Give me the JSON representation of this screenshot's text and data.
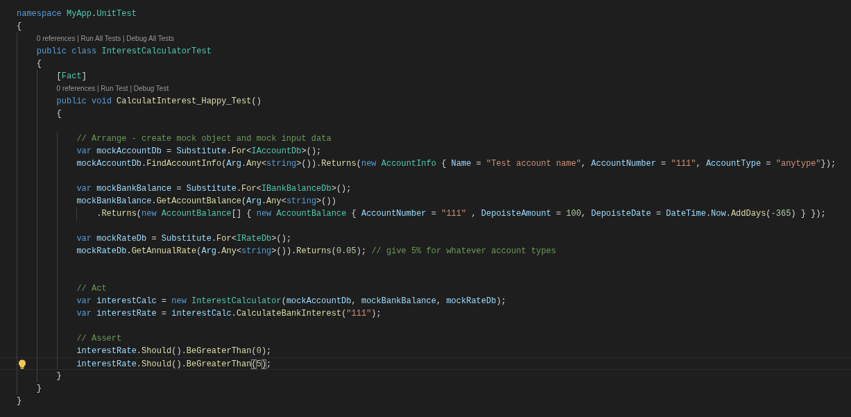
{
  "editor": {
    "lines": [
      {
        "kind": "code",
        "tokens": [
          {
            "t": "namespace",
            "kind": "keyword"
          },
          {
            "t": " MyApp",
            "kind": "type"
          },
          {
            "t": ".",
            "kind": "punctuation"
          },
          {
            "t": "UnitTest",
            "kind": "type"
          }
        ]
      },
      {
        "kind": "code",
        "tokens": [
          {
            "t": "{",
            "kind": "punctuation"
          }
        ]
      },
      {
        "kind": "codelens",
        "tokens": [
          {
            "t": "    0 references | Run All Tests | Debug All Tests",
            "kind": "lens"
          }
        ]
      },
      {
        "kind": "code",
        "tokens": [
          {
            "t": "    public",
            "kind": "keyword"
          },
          {
            "t": " class",
            "kind": "keyword"
          },
          {
            "t": " InterestCalculatorTest",
            "kind": "type"
          }
        ]
      },
      {
        "kind": "code",
        "tokens": [
          {
            "t": "    {",
            "kind": "punctuation"
          }
        ]
      },
      {
        "kind": "code",
        "tokens": [
          {
            "t": "        [",
            "kind": "punctuation"
          },
          {
            "t": "Fact",
            "kind": "type"
          },
          {
            "t": "]",
            "kind": "punctuation"
          }
        ]
      },
      {
        "kind": "codelens",
        "tokens": [
          {
            "t": "        0 references | Run Test | Debug Test",
            "kind": "lens"
          }
        ]
      },
      {
        "kind": "code",
        "tokens": [
          {
            "t": "        public",
            "kind": "keyword"
          },
          {
            "t": " void",
            "kind": "keyword"
          },
          {
            "t": " CalculatInterest_Happy_Test",
            "kind": "function"
          },
          {
            "t": "()",
            "kind": "punctuation"
          }
        ]
      },
      {
        "kind": "code",
        "tokens": [
          {
            "t": "        {",
            "kind": "punctuation"
          }
        ]
      },
      {
        "kind": "blank"
      },
      {
        "kind": "code",
        "tokens": [
          {
            "t": "            // Arrange - create mock object and mock input data",
            "kind": "comment"
          }
        ]
      },
      {
        "kind": "code",
        "tokens": [
          {
            "t": "            var",
            "kind": "keyword"
          },
          {
            "t": " mockAccountDb",
            "kind": "variable"
          },
          {
            "t": " = ",
            "kind": "punctuation"
          },
          {
            "t": "Substitute",
            "kind": "variable"
          },
          {
            "t": ".",
            "kind": "punctuation"
          },
          {
            "t": "For",
            "kind": "function"
          },
          {
            "t": "<",
            "kind": "punctuation"
          },
          {
            "t": "IAccountDb",
            "kind": "type"
          },
          {
            "t": ">();",
            "kind": "punctuation"
          }
        ]
      },
      {
        "kind": "code",
        "tokens": [
          {
            "t": "            mockAccountDb",
            "kind": "variable"
          },
          {
            "t": ".",
            "kind": "punctuation"
          },
          {
            "t": "FindAccountInfo",
            "kind": "function"
          },
          {
            "t": "(",
            "kind": "punctuation"
          },
          {
            "t": "Arg",
            "kind": "variable"
          },
          {
            "t": ".",
            "kind": "punctuation"
          },
          {
            "t": "Any",
            "kind": "function"
          },
          {
            "t": "<",
            "kind": "punctuation"
          },
          {
            "t": "string",
            "kind": "keyword"
          },
          {
            "t": ">()).",
            "kind": "punctuation"
          },
          {
            "t": "Returns",
            "kind": "function"
          },
          {
            "t": "(",
            "kind": "punctuation"
          },
          {
            "t": "new",
            "kind": "keyword"
          },
          {
            "t": " AccountInfo",
            "kind": "type"
          },
          {
            "t": " { ",
            "kind": "punctuation"
          },
          {
            "t": "Name",
            "kind": "variable"
          },
          {
            "t": " = ",
            "kind": "punctuation"
          },
          {
            "t": "\"Test account name\"",
            "kind": "string"
          },
          {
            "t": ", ",
            "kind": "punctuation"
          },
          {
            "t": "AccountNumber",
            "kind": "variable"
          },
          {
            "t": " = ",
            "kind": "punctuation"
          },
          {
            "t": "\"111\"",
            "kind": "string"
          },
          {
            "t": ", ",
            "kind": "punctuation"
          },
          {
            "t": "AccountType",
            "kind": "variable"
          },
          {
            "t": " = ",
            "kind": "punctuation"
          },
          {
            "t": "\"anytype\"",
            "kind": "string"
          },
          {
            "t": "});",
            "kind": "punctuation"
          }
        ]
      },
      {
        "kind": "blank"
      },
      {
        "kind": "code",
        "tokens": [
          {
            "t": "            var",
            "kind": "keyword"
          },
          {
            "t": " mockBankBalance",
            "kind": "variable"
          },
          {
            "t": " = ",
            "kind": "punctuation"
          },
          {
            "t": "Substitute",
            "kind": "variable"
          },
          {
            "t": ".",
            "kind": "punctuation"
          },
          {
            "t": "For",
            "kind": "function"
          },
          {
            "t": "<",
            "kind": "punctuation"
          },
          {
            "t": "IBankBalanceDb",
            "kind": "type"
          },
          {
            "t": ">();",
            "kind": "punctuation"
          }
        ]
      },
      {
        "kind": "code",
        "tokens": [
          {
            "t": "            mockBankBalance",
            "kind": "variable"
          },
          {
            "t": ".",
            "kind": "punctuation"
          },
          {
            "t": "GetAccountBalance",
            "kind": "function"
          },
          {
            "t": "(",
            "kind": "punctuation"
          },
          {
            "t": "Arg",
            "kind": "variable"
          },
          {
            "t": ".",
            "kind": "punctuation"
          },
          {
            "t": "Any",
            "kind": "function"
          },
          {
            "t": "<",
            "kind": "punctuation"
          },
          {
            "t": "string",
            "kind": "keyword"
          },
          {
            "t": ">())",
            "kind": "punctuation"
          }
        ]
      },
      {
        "kind": "code",
        "tokens": [
          {
            "t": "                .",
            "kind": "punctuation"
          },
          {
            "t": "Returns",
            "kind": "function"
          },
          {
            "t": "(",
            "kind": "punctuation"
          },
          {
            "t": "new",
            "kind": "keyword"
          },
          {
            "t": " AccountBalance",
            "kind": "type"
          },
          {
            "t": "[] { ",
            "kind": "punctuation"
          },
          {
            "t": "new",
            "kind": "keyword"
          },
          {
            "t": " AccountBalance",
            "kind": "type"
          },
          {
            "t": " { ",
            "kind": "punctuation"
          },
          {
            "t": "AccountNumber",
            "kind": "variable"
          },
          {
            "t": " = ",
            "kind": "punctuation"
          },
          {
            "t": "\"111\"",
            "kind": "string"
          },
          {
            "t": " , ",
            "kind": "punctuation"
          },
          {
            "t": "DepoisteAmount",
            "kind": "variable"
          },
          {
            "t": " = ",
            "kind": "punctuation"
          },
          {
            "t": "100",
            "kind": "number"
          },
          {
            "t": ", ",
            "kind": "punctuation"
          },
          {
            "t": "DepoisteDate",
            "kind": "variable"
          },
          {
            "t": " = ",
            "kind": "punctuation"
          },
          {
            "t": "DateTime",
            "kind": "variable"
          },
          {
            "t": ".",
            "kind": "punctuation"
          },
          {
            "t": "Now",
            "kind": "variable"
          },
          {
            "t": ".",
            "kind": "punctuation"
          },
          {
            "t": "AddDays",
            "kind": "function"
          },
          {
            "t": "(",
            "kind": "punctuation"
          },
          {
            "t": "-365",
            "kind": "number"
          },
          {
            "t": ") } });",
            "kind": "punctuation"
          }
        ]
      },
      {
        "kind": "blank"
      },
      {
        "kind": "code",
        "tokens": [
          {
            "t": "            var",
            "kind": "keyword"
          },
          {
            "t": " mockRateDb",
            "kind": "variable"
          },
          {
            "t": " = ",
            "kind": "punctuation"
          },
          {
            "t": "Substitute",
            "kind": "variable"
          },
          {
            "t": ".",
            "kind": "punctuation"
          },
          {
            "t": "For",
            "kind": "function"
          },
          {
            "t": "<",
            "kind": "punctuation"
          },
          {
            "t": "IRateDb",
            "kind": "type"
          },
          {
            "t": ">();",
            "kind": "punctuation"
          }
        ]
      },
      {
        "kind": "code",
        "tokens": [
          {
            "t": "            mockRateDb",
            "kind": "variable"
          },
          {
            "t": ".",
            "kind": "punctuation"
          },
          {
            "t": "GetAnnualRate",
            "kind": "function"
          },
          {
            "t": "(",
            "kind": "punctuation"
          },
          {
            "t": "Arg",
            "kind": "variable"
          },
          {
            "t": ".",
            "kind": "punctuation"
          },
          {
            "t": "Any",
            "kind": "function"
          },
          {
            "t": "<",
            "kind": "punctuation"
          },
          {
            "t": "string",
            "kind": "keyword"
          },
          {
            "t": ">()).",
            "kind": "punctuation"
          },
          {
            "t": "Returns",
            "kind": "function"
          },
          {
            "t": "(",
            "kind": "punctuation"
          },
          {
            "t": "0.05",
            "kind": "number"
          },
          {
            "t": "); ",
            "kind": "punctuation"
          },
          {
            "t": "// give 5% for whatever account types",
            "kind": "comment"
          }
        ]
      },
      {
        "kind": "blank"
      },
      {
        "kind": "blank"
      },
      {
        "kind": "code",
        "tokens": [
          {
            "t": "            // Act",
            "kind": "comment"
          }
        ]
      },
      {
        "kind": "code",
        "tokens": [
          {
            "t": "            var",
            "kind": "keyword"
          },
          {
            "t": " interestCalc",
            "kind": "variable"
          },
          {
            "t": " = ",
            "kind": "punctuation"
          },
          {
            "t": "new",
            "kind": "keyword"
          },
          {
            "t": " InterestCalculator",
            "kind": "type"
          },
          {
            "t": "(",
            "kind": "punctuation"
          },
          {
            "t": "mockAccountDb",
            "kind": "variable"
          },
          {
            "t": ", ",
            "kind": "punctuation"
          },
          {
            "t": "mockBankBalance",
            "kind": "variable"
          },
          {
            "t": ", ",
            "kind": "punctuation"
          },
          {
            "t": "mockRateDb",
            "kind": "variable"
          },
          {
            "t": ");",
            "kind": "punctuation"
          }
        ]
      },
      {
        "kind": "code",
        "tokens": [
          {
            "t": "            var",
            "kind": "keyword"
          },
          {
            "t": " interestRate",
            "kind": "variable"
          },
          {
            "t": " = ",
            "kind": "punctuation"
          },
          {
            "t": "interestCalc",
            "kind": "variable"
          },
          {
            "t": ".",
            "kind": "punctuation"
          },
          {
            "t": "CalculateBankInterest",
            "kind": "function"
          },
          {
            "t": "(",
            "kind": "punctuation"
          },
          {
            "t": "\"111\"",
            "kind": "string"
          },
          {
            "t": ");",
            "kind": "punctuation"
          }
        ]
      },
      {
        "kind": "blank"
      },
      {
        "kind": "code",
        "tokens": [
          {
            "t": "            // Assert",
            "kind": "comment"
          }
        ]
      },
      {
        "kind": "code",
        "tokens": [
          {
            "t": "            interestRate",
            "kind": "variable"
          },
          {
            "t": ".",
            "kind": "punctuation"
          },
          {
            "t": "Should",
            "kind": "function"
          },
          {
            "t": "().",
            "kind": "punctuation"
          },
          {
            "t": "BeGreaterThan",
            "kind": "function"
          },
          {
            "t": "(",
            "kind": "punctuation"
          },
          {
            "t": "0",
            "kind": "number"
          },
          {
            "t": ");",
            "kind": "punctuation"
          }
        ]
      },
      {
        "kind": "code",
        "lightbulb": true,
        "current": true,
        "tokens": [
          {
            "t": "            interestRate",
            "kind": "variable"
          },
          {
            "t": ".",
            "kind": "punctuation"
          },
          {
            "t": "Should",
            "kind": "function"
          },
          {
            "t": "().",
            "kind": "punctuation"
          },
          {
            "t": "BeGreaterThan",
            "kind": "function"
          },
          {
            "t": "(",
            "kind": "match"
          },
          {
            "t": "5",
            "kind": "number"
          },
          {
            "t": ")",
            "kind": "match"
          },
          {
            "t": ";",
            "kind": "punctuation"
          }
        ]
      },
      {
        "kind": "code",
        "tokens": [
          {
            "t": "        }",
            "kind": "punctuation"
          }
        ]
      },
      {
        "kind": "code",
        "tokens": [
          {
            "t": "    }",
            "kind": "punctuation"
          }
        ]
      },
      {
        "kind": "code",
        "tokens": [
          {
            "t": "}",
            "kind": "punctuation"
          }
        ]
      }
    ]
  }
}
